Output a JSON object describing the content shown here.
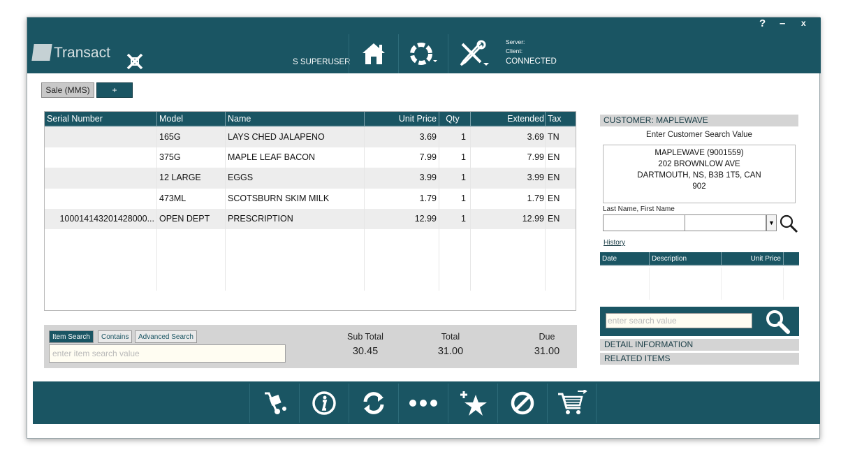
{
  "window": {
    "help_label": "?",
    "minimize_label": "–",
    "close_label": "x"
  },
  "header": {
    "brand": "Transact",
    "user": "S SUPERUSER",
    "server_label": "Server:",
    "client_label": "Client:",
    "connection_status": "CONNECTED"
  },
  "tabs": {
    "sale_label": "Sale (MMS)",
    "add_label": "+"
  },
  "grid": {
    "columns": [
      "Serial Number",
      "Model",
      "Name",
      "Unit Price",
      "Qty",
      "Extended",
      "Tax"
    ],
    "rows": [
      {
        "serial": "",
        "model": "165G",
        "name": "LAYS CHED JALAPENO",
        "unit_price": "3.69",
        "qty": "1",
        "extended": "3.69",
        "tax": "TN"
      },
      {
        "serial": "",
        "model": "375G",
        "name": "MAPLE LEAF BACON",
        "unit_price": "7.99",
        "qty": "1",
        "extended": "7.99",
        "tax": "EN"
      },
      {
        "serial": "",
        "model": "12 LARGE",
        "name": "EGGS",
        "unit_price": "3.99",
        "qty": "1",
        "extended": "3.99",
        "tax": "EN"
      },
      {
        "serial": "",
        "model": "473ML",
        "name": "SCOTSBURN SKIM MILK",
        "unit_price": "1.79",
        "qty": "1",
        "extended": "1.79",
        "tax": "EN"
      },
      {
        "serial": "100014143201428000...",
        "model": "OPEN DEPT",
        "name": "PRESCRIPTION",
        "unit_price": "12.99",
        "qty": "1",
        "extended": "12.99",
        "tax": "EN"
      }
    ]
  },
  "item_search": {
    "tabs": [
      "Item Search",
      "Contains",
      "Advanced Search"
    ],
    "placeholder": "enter item search value"
  },
  "totals": {
    "subtotal_label": "Sub Total",
    "subtotal": "30.45",
    "total_label": "Total",
    "total": "31.00",
    "due_label": "Due",
    "due": "31.00"
  },
  "customer": {
    "header": "CUSTOMER:  MAPLEWAVE",
    "prompt": "Enter Customer Search Value",
    "address_lines": [
      "MAPLEWAVE (9001559)",
      "202 BROWNLOW AVE",
      "DARTMOUTH, NS, B3B 1T5, CAN",
      "902"
    ],
    "name_label": "Last Name, First Name",
    "history_link": "History",
    "history_columns": [
      "Date",
      "Description",
      "Unit Price"
    ],
    "search_placeholder": "enter search value",
    "detail_label": "DETAIL INFORMATION",
    "related_label": "RELATED ITEMS"
  },
  "colors": {
    "primary": "#1a5563",
    "panel": "#d4d4d4",
    "input_bg": "#fffdf2"
  },
  "footer_icons": [
    "dolly-icon",
    "info-icon",
    "refresh-icon",
    "more-icon",
    "add-favorite-icon",
    "void-icon",
    "cart-icon"
  ]
}
